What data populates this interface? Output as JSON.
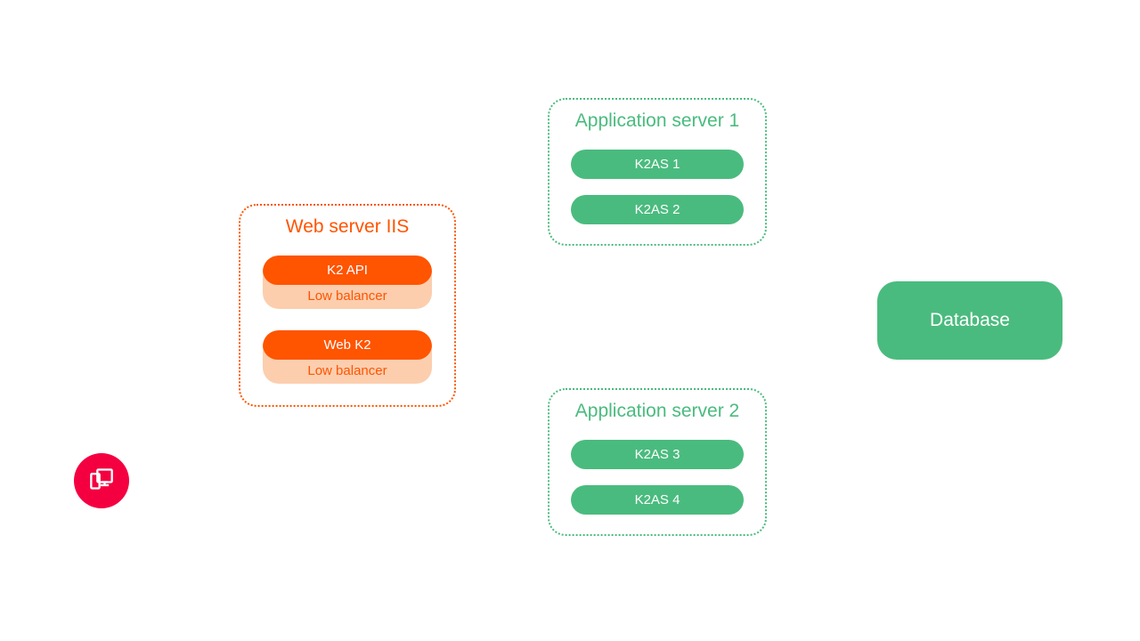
{
  "client": {
    "icon": "devices-icon"
  },
  "webServer": {
    "title": "Web server IIS",
    "items": [
      {
        "name": "K2 API",
        "note": "Low balancer"
      },
      {
        "name": "Web K2",
        "note": "Low balancer"
      }
    ]
  },
  "appServers": [
    {
      "title": "Application server 1",
      "items": [
        "K2AS 1",
        "K2AS 2"
      ]
    },
    {
      "title": "Application server 2",
      "items": [
        "K2AS 3",
        "K2AS 4"
      ]
    }
  ],
  "database": {
    "label": "Database"
  },
  "colors": {
    "client": "#f40041",
    "web": "#ff5400",
    "webLight": "#fcceae",
    "app": "#4abb7e"
  }
}
